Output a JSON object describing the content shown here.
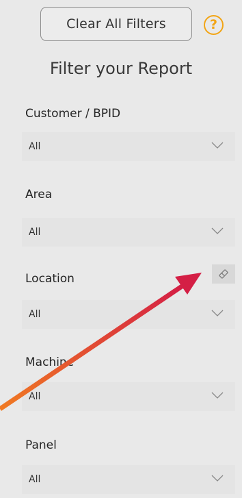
{
  "toolbar": {
    "clear_label": "Clear All Filters",
    "help_icon": "question-circle-icon",
    "help_glyph": "?"
  },
  "panel": {
    "title": "Filter your Report"
  },
  "filters": [
    {
      "label": "Customer / BPID",
      "value": "All"
    },
    {
      "label": "Area",
      "value": "All"
    },
    {
      "label": "Location",
      "value": "All"
    },
    {
      "label": "Machine",
      "value": "All"
    },
    {
      "label": "Panel",
      "value": "All"
    }
  ],
  "icons": {
    "dropdown": "chevron-down-icon",
    "clear_location": "eraser-icon"
  },
  "colors": {
    "background": "#e9e9e9",
    "dropdown_background": "#e4e4e4",
    "help_accent": "#f2a516",
    "arrow_start": "#f07a22",
    "arrow_end": "#d41f45"
  }
}
